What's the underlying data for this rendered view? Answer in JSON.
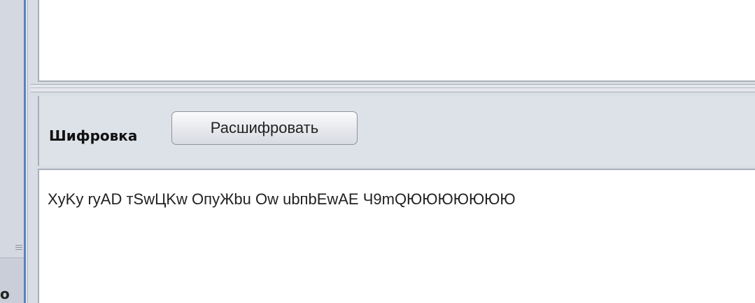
{
  "toolbar": {
    "label": "Шифровка",
    "decrypt_button_label": "Расшифровать"
  },
  "output": {
    "text": "XyKy ryAD тSwЦKw ОпуЖbu Оw ubпbEwAE Ч9mQЮЮЮЮЮЮЮ"
  },
  "left_panel": {
    "fragment_text": "о"
  },
  "colors": {
    "panel_bg": "#d9dde5",
    "accent_line": "#5a7fb6"
  }
}
